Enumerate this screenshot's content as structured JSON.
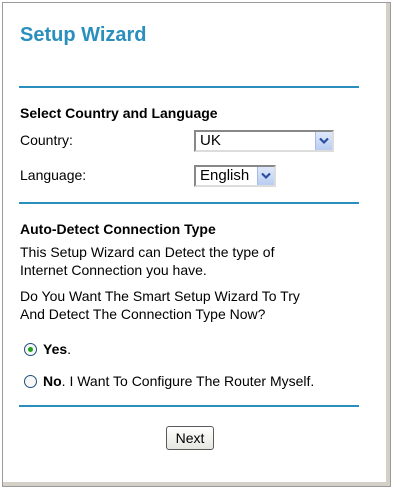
{
  "header": {
    "title": "Setup Wizard"
  },
  "country_language": {
    "heading": "Select Country and Language",
    "country_label": "Country:",
    "country_value": "UK",
    "language_label": "Language:",
    "language_value": "English"
  },
  "auto_detect": {
    "heading": "Auto-Detect Connection Type",
    "desc_line1": "This Setup Wizard can Detect the type of",
    "desc_line2": "Internet Connection you have.",
    "question_line1": "Do You Want The Smart Setup Wizard To Try",
    "question_line2": "And Detect The Connection Type Now?",
    "yes_bold": "Yes",
    "yes_rest": ".",
    "no_bold": "No",
    "no_rest": ". I Want To Configure The Router Myself.",
    "selected": "yes"
  },
  "footer": {
    "next_label": "Next"
  },
  "colors": {
    "accent": "#2a8fbd",
    "radio_selected": "#21a121"
  },
  "icons": {
    "dropdown": "chevron-down-icon"
  }
}
